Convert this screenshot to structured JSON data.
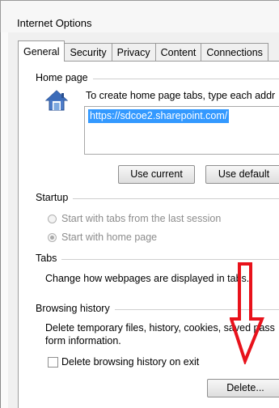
{
  "window": {
    "title": "Internet Options"
  },
  "tabs": [
    {
      "label": "General",
      "active": true
    },
    {
      "label": "Security",
      "active": false
    },
    {
      "label": "Privacy",
      "active": false
    },
    {
      "label": "Content",
      "active": false
    },
    {
      "label": "Connections",
      "active": false
    }
  ],
  "home_page": {
    "label": "Home page",
    "instruction": "To create home page tabs, type each addr",
    "url": "https://sdcoe2.sharepoint.com/",
    "use_current": "Use current",
    "use_default": "Use default"
  },
  "startup": {
    "label": "Startup",
    "option_last_session": "Start with tabs from the last session",
    "option_home_page": "Start with home page",
    "selected": "home_page"
  },
  "tabs_section": {
    "label": "Tabs",
    "description": "Change how webpages are displayed in tabs."
  },
  "browsing_history": {
    "label": "Browsing history",
    "description_line1": "Delete temporary files, history, cookies, saved pass",
    "description_line2": "form information.",
    "delete_on_exit_label": "Delete browsing history on exit",
    "delete_on_exit_checked": false,
    "delete_button": "Delete..."
  },
  "colors": {
    "annotation_arrow": "#e8121b",
    "selection": "#3399ff"
  }
}
